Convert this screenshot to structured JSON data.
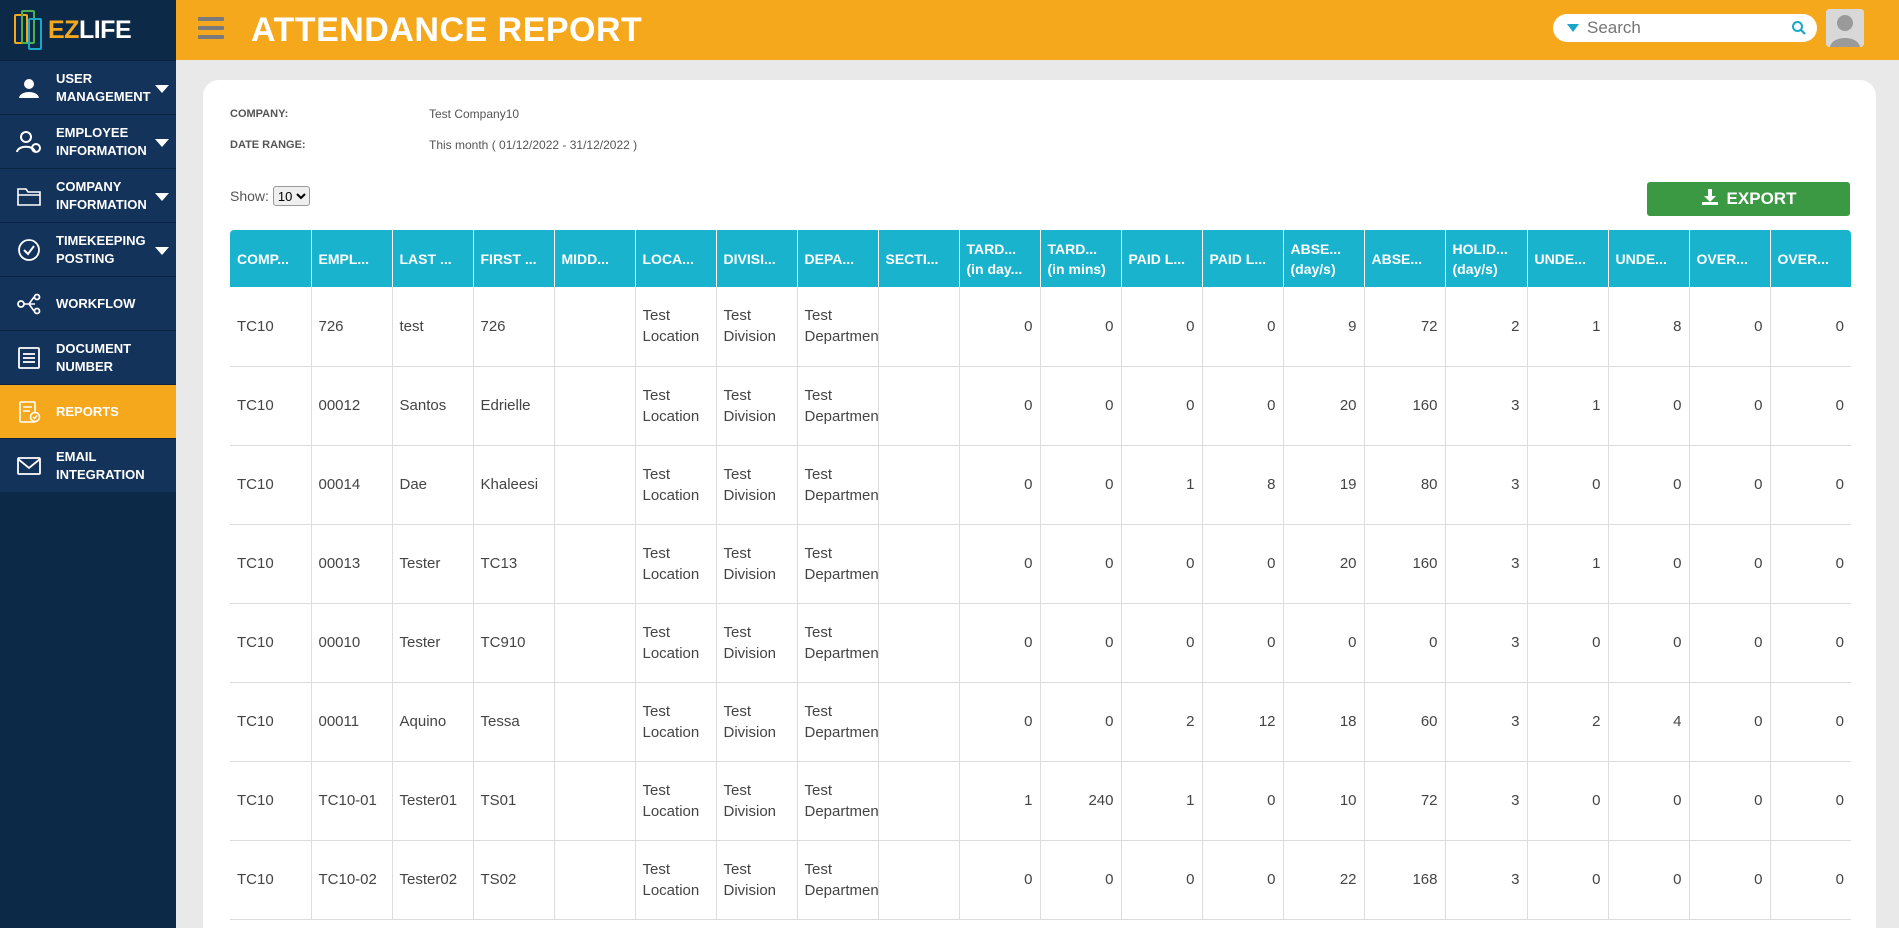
{
  "app": {
    "logo_ez": "EZ",
    "logo_life": "LIFE"
  },
  "sidebar": {
    "items": [
      {
        "label": "USER MANAGEMENT",
        "icon": "user-icon",
        "caret": true,
        "active": false
      },
      {
        "label": "EMPLOYEE INFORMATION",
        "icon": "employee-icon",
        "caret": true,
        "active": false
      },
      {
        "label": "COMPANY INFORMATION",
        "icon": "folder-icon",
        "caret": true,
        "active": false
      },
      {
        "label": "TIMEKEEPING POSTING",
        "icon": "check-circle-icon",
        "caret": true,
        "active": false
      },
      {
        "label": "WORKFLOW",
        "icon": "workflow-icon",
        "caret": false,
        "active": false
      },
      {
        "label": "DOCUMENT NUMBER",
        "icon": "document-list-icon",
        "caret": false,
        "active": false
      },
      {
        "label": "REPORTS",
        "icon": "report-icon",
        "caret": false,
        "active": true
      },
      {
        "label": "EMAIL INTEGRATION",
        "icon": "mail-icon",
        "caret": false,
        "active": false
      }
    ]
  },
  "header": {
    "title": "ATTENDANCE REPORT",
    "search_placeholder": "Search"
  },
  "report": {
    "company_label": "COMPANY:",
    "company_value": "Test Company10",
    "date_label": "DATE RANGE:",
    "date_value": "This month ( 01/12/2022 - 31/12/2022 )",
    "show_label": "Show:",
    "show_value": "10",
    "export_label": "EXPORT"
  },
  "table": {
    "headers": [
      [
        "COMP..."
      ],
      [
        "EMPL..."
      ],
      [
        "LAST ..."
      ],
      [
        "FIRST ..."
      ],
      [
        "MIDD..."
      ],
      [
        "LOCA..."
      ],
      [
        "DIVISI..."
      ],
      [
        "DEPA..."
      ],
      [
        "SECTI..."
      ],
      [
        "TARD...",
        "(in day..."
      ],
      [
        "TARD...",
        "(in mins)"
      ],
      [
        "PAID L..."
      ],
      [
        "PAID L..."
      ],
      [
        "ABSE...",
        "(day/s)"
      ],
      [
        "ABSE..."
      ],
      [
        "HOLID...",
        "(day/s)"
      ],
      [
        "UNDE..."
      ],
      [
        "UNDE..."
      ],
      [
        "OVER..."
      ],
      [
        "OVER..."
      ]
    ],
    "rows": [
      [
        "TC10",
        "726",
        "test",
        "726",
        "",
        "Test Location",
        "Test Division",
        "Test Department",
        "",
        "0",
        "0",
        "0",
        "0",
        "9",
        "72",
        "2",
        "1",
        "8",
        "0",
        "0"
      ],
      [
        "TC10",
        "00012",
        "Santos",
        "Edrielle",
        "",
        "Test Location",
        "Test Division",
        "Test Department",
        "",
        "0",
        "0",
        "0",
        "0",
        "20",
        "160",
        "3",
        "1",
        "0",
        "0",
        "0"
      ],
      [
        "TC10",
        "00014",
        "Dae",
        "Khaleesi",
        "",
        "Test Location",
        "Test Division",
        "Test Department",
        "",
        "0",
        "0",
        "1",
        "8",
        "19",
        "80",
        "3",
        "0",
        "0",
        "0",
        "0"
      ],
      [
        "TC10",
        "00013",
        "Tester",
        "TC13",
        "",
        "Test Location",
        "Test Division",
        "Test Department",
        "",
        "0",
        "0",
        "0",
        "0",
        "20",
        "160",
        "3",
        "1",
        "0",
        "0",
        "0"
      ],
      [
        "TC10",
        "00010",
        "Tester",
        "TC910",
        "",
        "Test Location",
        "Test Division",
        "Test Department",
        "",
        "0",
        "0",
        "0",
        "0",
        "0",
        "0",
        "3",
        "0",
        "0",
        "0",
        "0"
      ],
      [
        "TC10",
        "00011",
        "Aquino",
        "Tessa",
        "",
        "Test Location",
        "Test Division",
        "Test Department",
        "",
        "0",
        "0",
        "2",
        "12",
        "18",
        "60",
        "3",
        "2",
        "4",
        "0",
        "0"
      ],
      [
        "TC10",
        "TC10-01",
        "Tester01",
        "TS01",
        "",
        "Test Location",
        "Test Division",
        "Test Department",
        "",
        "1",
        "240",
        "1",
        "0",
        "10",
        "72",
        "3",
        "0",
        "0",
        "0",
        "0"
      ],
      [
        "TC10",
        "TC10-02",
        "Tester02",
        "TS02",
        "",
        "Test Location",
        "Test Division",
        "Test Department",
        "",
        "0",
        "0",
        "0",
        "0",
        "22",
        "168",
        "3",
        "0",
        "0",
        "0",
        "0"
      ]
    ]
  },
  "colors": {
    "accent": "#f5a81c",
    "sidebar": "#0c2a47",
    "table_header": "#1ab3cd",
    "export": "#3b9943"
  }
}
